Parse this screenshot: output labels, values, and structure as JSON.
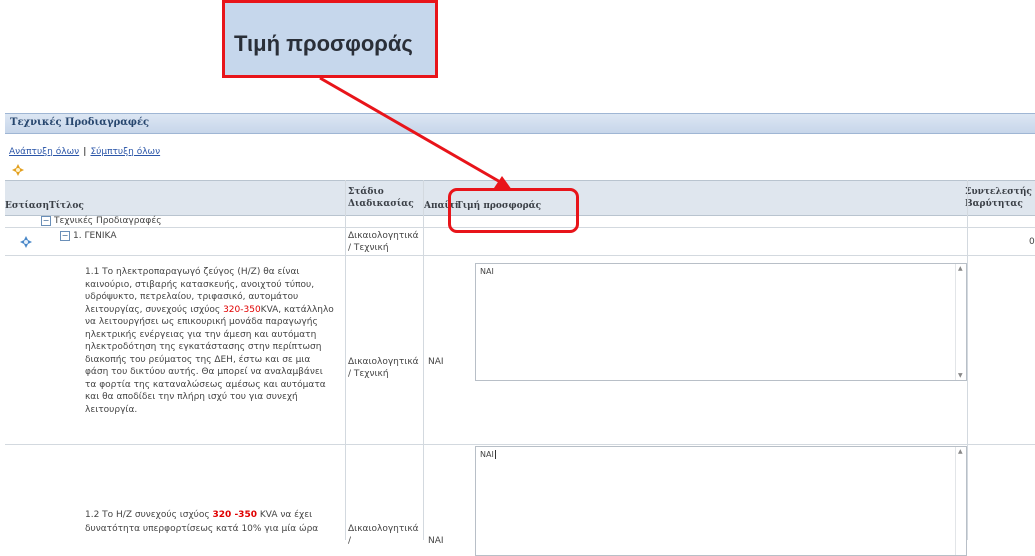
{
  "callout": {
    "label": "Τιμή προσφοράς"
  },
  "section": {
    "title": "Τεχνικές Προδιαγραφές"
  },
  "links": {
    "expand_all": "Ανάπτυξη όλων",
    "separator": "|",
    "collapse_all": "Σύμπτυξη όλων"
  },
  "columns": {
    "focus": "Εστίαση",
    "title": "Τίτλος",
    "stage": "Στάδιο Διαδικασίας",
    "response": "Απαίτηση",
    "offer": "Τιμή προσφοράς",
    "weight": "Συντελεστής Βαρύτητας"
  },
  "rows": {
    "group": {
      "label": "Τεχνικές Προδιαγραφές"
    },
    "general": {
      "label": "1. ΓΕΝΙΚΑ",
      "stage": "Δικαιολογητικά / Τεχνική",
      "weight": "0"
    },
    "item1": {
      "text_before": "1.1 Το ηλεκτροπαραγωγό ζεύγος (Η/Ζ) θα είναι καινούριο, στιβαρής κατασκευής, ανοιχτού τύπου, υδρόψυκτο, πετρελαίου, τριφασικό, αυτομάτου λειτουργίας, συνεχούς ισχύος ",
      "text_red": "320-350",
      "text_after": "KVA, κατάλληλο να λειτουργήσει ως επικουρική μονάδα παραγωγής ηλεκτρικής ενέργειας για την άμεση και αυτόματη ηλεκτροδότηση της εγκατάστασης στην περίπτωση διακοπής του ρεύματος της ΔΕΗ, έστω και σε μια φάση του δικτύου αυτής. Θα μπορεί να αναλαμβάνει τα φορτία της καταναλώσεως αμέσως και αυτόματα και θα αποδίδει την πλήρη ισχύ του για συνεχή λειτουργία.",
      "stage": "Δικαιολογητικά / Τεχνική",
      "response": "ΝΑΙ",
      "offer": "ΝΑΙ"
    },
    "item2": {
      "text_before": "1.2 Το Η/Ζ συνεχούς ισχύος ",
      "text_red": "320 -350",
      "text_after": " KVA να έχει δυνατότητα υπερφορτίσεως κατά 10% για μία ώρα",
      "stage": "Δικαιολογητικά /",
      "response": "ΝΑΙ",
      "offer": "ΝΑΙ"
    }
  },
  "colors": {
    "highlight": "#e8141a",
    "header_bg": "#dfe6ee",
    "link": "#2a55a8"
  }
}
